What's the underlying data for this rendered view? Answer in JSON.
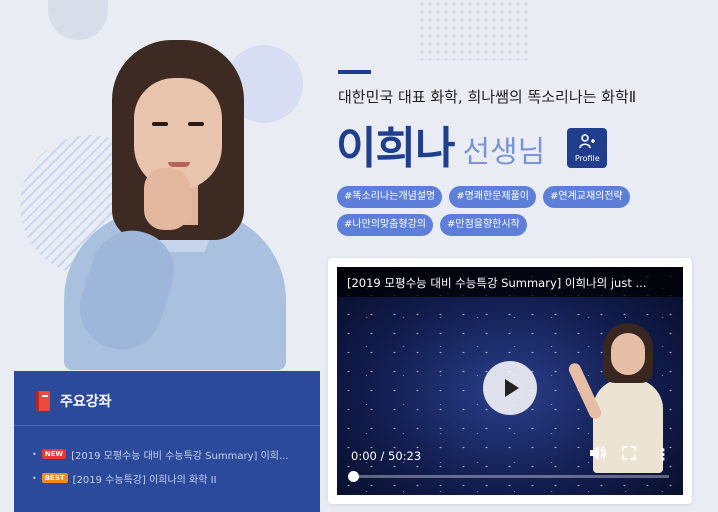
{
  "header": {
    "tagline": "대한민국 대표 화학, 희나쌤의 똑소리나는 화학Ⅱ",
    "name": "이희나",
    "role": "선생님",
    "profile_label": "Profile"
  },
  "tags": [
    "#똑소리나는개념설명",
    "#명쾌한문제풀이",
    "#연계교재의전략",
    "#나만의맞춤형강의",
    "#만점을향한시작"
  ],
  "course_box": {
    "title": "주요강좌",
    "items": [
      {
        "badge": "NEW",
        "text": "[2019 모평수능 대비 수능특강 Summary] 이희..."
      },
      {
        "badge": "BEST",
        "text": "[2019 수능특강] 이희나의 화학 II"
      }
    ]
  },
  "video": {
    "title": "[2019 모평수능 대비 수능특강 Summary] 이희나의 just ...",
    "time": "0:00 / 50:23",
    "progress": 0
  },
  "colors": {
    "accent": "#1f3e8e",
    "tag": "#5d7fd9",
    "course_box": "#2b4a9b",
    "badge_new": "#e83a33",
    "badge_best": "#f28b1f"
  },
  "icons": {
    "profile": "user-plus-icon",
    "course": "book-icon",
    "play": "play-icon",
    "volume": "volume-icon",
    "fullscreen": "fullscreen-icon",
    "more": "more-vertical-icon"
  }
}
